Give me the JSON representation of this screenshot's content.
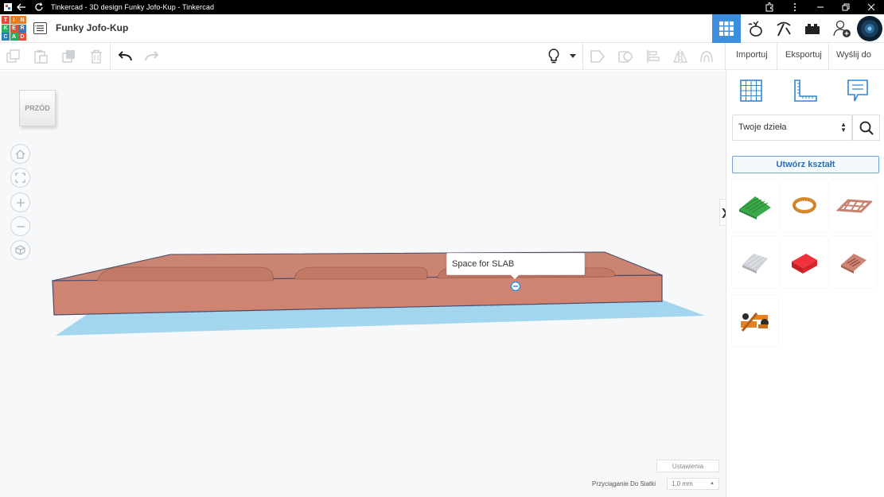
{
  "titlebar": {
    "title": "Tinkercad - 3D design Funky Jofo-Kup - Tinkercad",
    "icons": [
      "app-icon",
      "back-arrow-icon",
      "reload-icon",
      "extensions-icon",
      "more-icon",
      "minimize-icon",
      "restore-icon",
      "close-icon"
    ]
  },
  "logo": {
    "letters": [
      "T",
      "I",
      "N",
      "K",
      "E",
      "R",
      "C",
      "A",
      "D"
    ],
    "colors": [
      "#e74c3c",
      "#e67e22",
      "#e67e22",
      "#27ae60",
      "#e74c3c",
      "#2980b9",
      "#2980b9",
      "#27ae60",
      "#e74c3c"
    ]
  },
  "header": {
    "design_name": "Funky Jofo-Kup",
    "buttons": [
      "3d-design-grid",
      "sim-lab",
      "build-bricks",
      "lego-bricks",
      "add-user",
      "user-avatar"
    ],
    "accent": "#3d8edc"
  },
  "toolbar": {
    "import_label": "Importuj",
    "export_label": "Eksportuj",
    "send_label": "Wyślij do"
  },
  "viewport": {
    "viewcube_label": "PRZÓD",
    "tooltip": "Space for SLAB",
    "settings_label": "Ustawienia",
    "snap_label": "Przyciąganie Do Siatki",
    "snap_value": "1,0 mm",
    "shape_color": "#cf8472",
    "grid_color": "#8ccbea"
  },
  "panel": {
    "library_value": "Twoje dzieła",
    "create_shape_label": "Utwórz kształt",
    "shapes": [
      "green-roof-shape",
      "orange-ring-shape",
      "grid-frame-shape",
      "gray-slab-shape",
      "red-box-shape",
      "engraved-plate-shape",
      "orange-mechanism-shape"
    ]
  }
}
